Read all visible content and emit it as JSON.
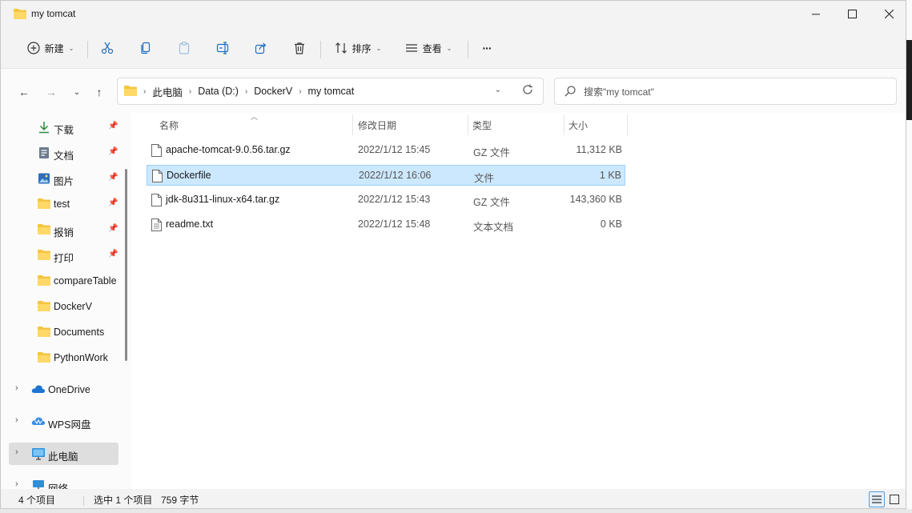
{
  "window": {
    "title": "my tomcat"
  },
  "toolbar": {
    "new_label": "新建",
    "sort_label": "排序",
    "view_label": "查看",
    "more_label": "···"
  },
  "address": {
    "crumbs": [
      "此电脑",
      "Data (D:)",
      "DockerV",
      "my tomcat"
    ]
  },
  "search": {
    "placeholder": "搜索\"my tomcat\""
  },
  "nav": {
    "quick": [
      {
        "label": "下载",
        "icon": "download-icon",
        "pinned": true
      },
      {
        "label": "文档",
        "icon": "document-icon",
        "pinned": true
      },
      {
        "label": "图片",
        "icon": "picture-icon",
        "pinned": true
      },
      {
        "label": "test",
        "icon": "folder-icon",
        "pinned": true
      },
      {
        "label": "报销",
        "icon": "folder-icon",
        "pinned": true
      },
      {
        "label": "打印",
        "icon": "folder-icon",
        "pinned": true
      },
      {
        "label": "compareTable",
        "icon": "folder-icon",
        "pinned": false
      },
      {
        "label": "DockerV",
        "icon": "folder-icon",
        "pinned": false
      },
      {
        "label": "Documents",
        "icon": "folder-icon",
        "pinned": false
      },
      {
        "label": "PythonWork",
        "icon": "folder-icon",
        "pinned": false
      }
    ],
    "roots": [
      {
        "label": "OneDrive",
        "icon": "cloud-icon"
      },
      {
        "label": "WPS网盘",
        "icon": "wps-cloud-icon"
      },
      {
        "label": "此电脑",
        "icon": "computer-icon",
        "selected": true
      },
      {
        "label": "网络",
        "icon": "network-icon"
      }
    ]
  },
  "columns": {
    "name": "名称",
    "date": "修改日期",
    "type": "类型",
    "size": "大小"
  },
  "files": [
    {
      "name": "apache-tomcat-9.0.56.tar.gz",
      "date": "2022/1/12 15:45",
      "type": "GZ 文件",
      "size": "11,312 KB",
      "selected": false
    },
    {
      "name": "Dockerfile",
      "date": "2022/1/12 16:06",
      "type": "文件",
      "size": "1 KB",
      "selected": true
    },
    {
      "name": "jdk-8u311-linux-x64.tar.gz",
      "date": "2022/1/12 15:43",
      "type": "GZ 文件",
      "size": "143,360 KB",
      "selected": false
    },
    {
      "name": "readme.txt",
      "date": "2022/1/12 15:48",
      "type": "文本文档",
      "size": "0 KB",
      "selected": false
    }
  ],
  "status": {
    "count": "4 个项目",
    "selected": "选中 1 个项目",
    "bytes": "759 字节"
  }
}
